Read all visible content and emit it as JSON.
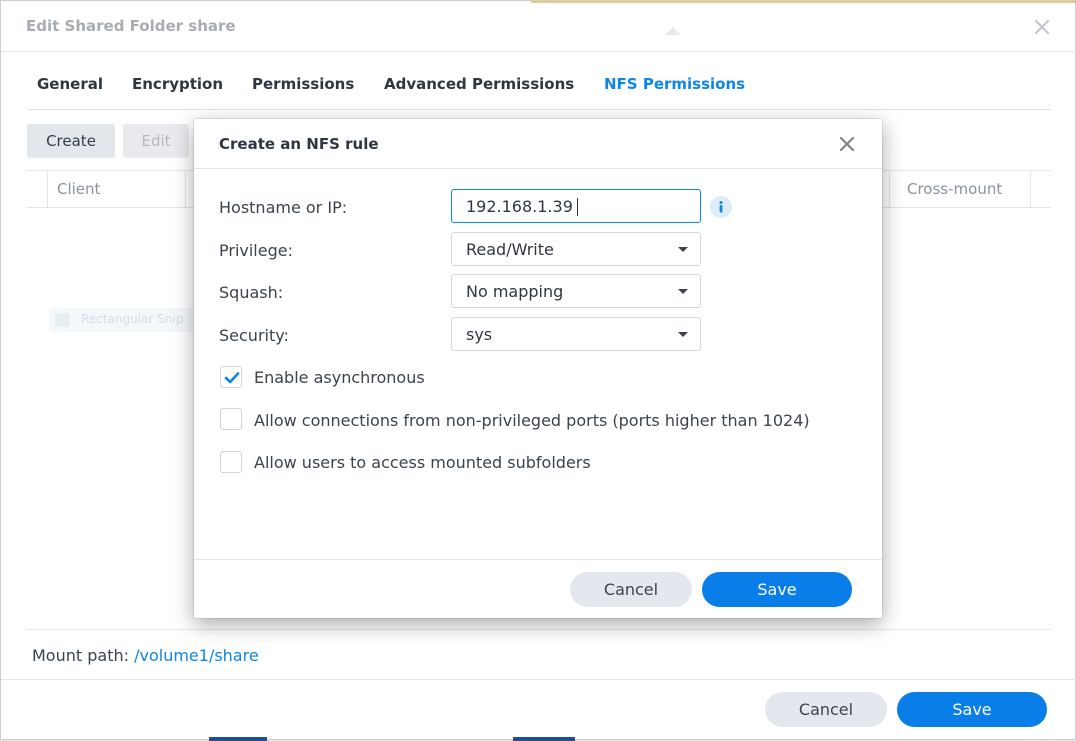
{
  "outer": {
    "title": "Edit Shared Folder share",
    "tabs": [
      {
        "label": "General"
      },
      {
        "label": "Encryption"
      },
      {
        "label": "Permissions"
      },
      {
        "label": "Advanced Permissions"
      },
      {
        "label": "NFS Permissions"
      }
    ],
    "active_tab": "NFS Permissions",
    "toolbar": {
      "create_label": "Create",
      "edit_label": "Edit"
    },
    "table": {
      "columns": [
        "Client",
        "Cross-mount"
      ]
    },
    "ghost_label": "Rectangular Snip",
    "mount_label": "Mount path:",
    "mount_path": "/volume1/share",
    "cancel_label": "Cancel",
    "save_label": "Save"
  },
  "modal": {
    "title": "Create an NFS rule",
    "fields": {
      "hostname": {
        "label": "Hostname or IP:",
        "value": "192.168.1.39"
      },
      "privilege": {
        "label": "Privilege:",
        "value": "Read/Write"
      },
      "squash": {
        "label": "Squash:",
        "value": "No mapping"
      },
      "security": {
        "label": "Security:",
        "value": "sys"
      }
    },
    "checkboxes": [
      {
        "label": "Enable asynchronous",
        "checked": true
      },
      {
        "label": "Allow connections from non-privileged ports (ports higher than 1024)",
        "checked": false
      },
      {
        "label": "Allow users to access mounted subfolders",
        "checked": false
      }
    ],
    "cancel_label": "Cancel",
    "save_label": "Save"
  },
  "colors": {
    "accent": "#0d86e8",
    "primary_button": "#0a7ee8"
  }
}
